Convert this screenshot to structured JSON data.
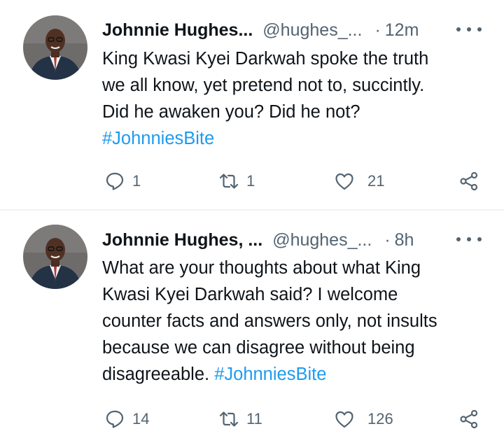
{
  "tweets": [
    {
      "author_name": "Johnnie Hughes...",
      "handle": "@hughes_...",
      "separator": "·",
      "time": "12m",
      "text_lines": [
        "King Kwasi Kyei Darkwah spoke the truth",
        "we all know, yet pretend not to, succintly.",
        "Did he awaken you? Did he not?"
      ],
      "hashtag": "#JohnniesBite",
      "reply_count": "1",
      "retweet_count": "1",
      "like_count": "21"
    },
    {
      "author_name": "Johnnie Hughes, ...",
      "handle": "@hughes_...",
      "separator": "·",
      "time": "8h",
      "text_lines": [
        "What are your thoughts about what King",
        "Kwasi Kyei Darkwah said? I welcome",
        "counter facts and answers only, not insults",
        "because we can disagree without being",
        "disagreeable. "
      ],
      "hashtag": "#JohnniesBite",
      "reply_count": "14",
      "retweet_count": "11",
      "like_count": "126"
    }
  ],
  "icons": {
    "avatar": "avatar-photo",
    "more": "more-options-icon",
    "reply": "reply-icon",
    "retweet": "retweet-icon",
    "like": "heart-icon",
    "share": "share-icon"
  },
  "colors": {
    "text_primary": "#0f1419",
    "text_secondary": "#536471",
    "hashtag": "#1d9bf0",
    "divider": "#eff3f4"
  }
}
